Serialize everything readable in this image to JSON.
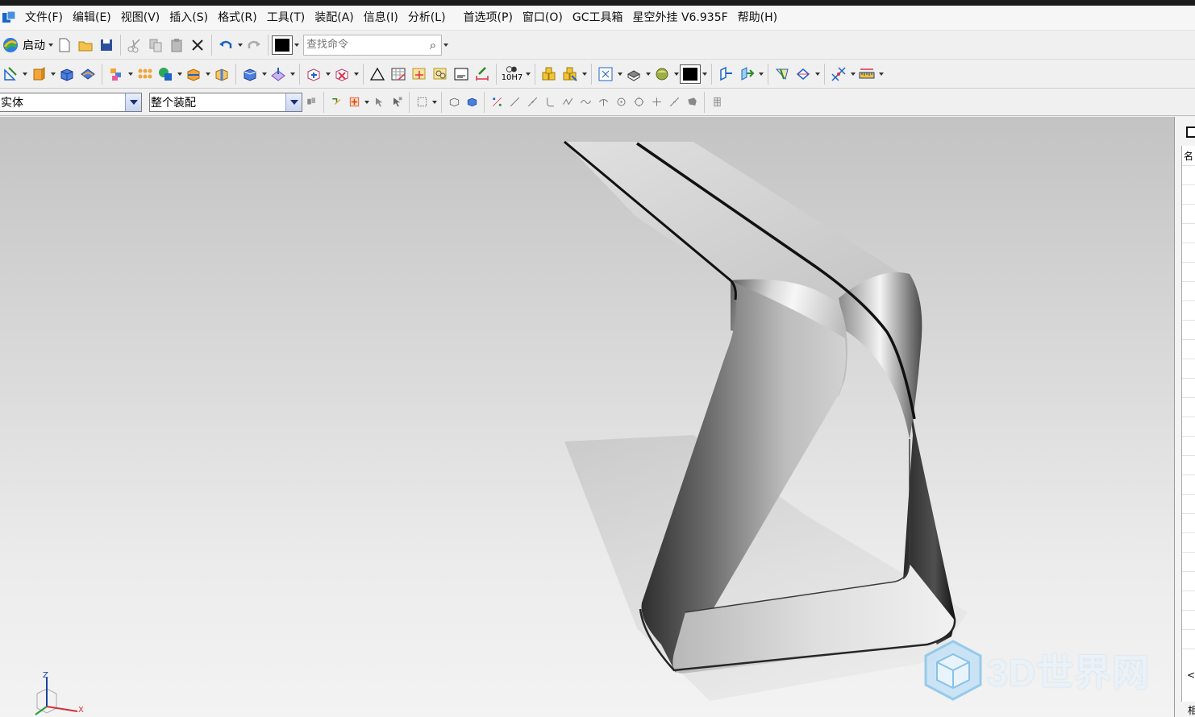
{
  "menu": {
    "items": [
      "文件(F)",
      "编辑(E)",
      "视图(V)",
      "插入(S)",
      "格式(R)",
      "工具(T)",
      "装配(A)",
      "信息(I)",
      "分析(L)",
      "首选项(P)",
      "窗口(O)",
      "GC工具箱",
      "星空外挂 V6.935F",
      "帮助(H)"
    ]
  },
  "toolbar": {
    "start_label": "启动",
    "search_placeholder": "查找命令",
    "fit_label": "10H7"
  },
  "selection": {
    "filter_value": "实体",
    "scope_value": "整个装配"
  },
  "colors": {
    "accent": "#1b64c8",
    "toolbar_bg": "#f0f0f0",
    "viewport_top": "#c3c3c3",
    "viewport_bottom": "#f3f3f3"
  },
  "right_panel": {
    "top_char": "名",
    "bottom_char": "相",
    "arrow": "<"
  },
  "triad": {
    "z_label": "Z",
    "x_label": "X"
  },
  "watermark": {
    "text": "3D世界网"
  }
}
